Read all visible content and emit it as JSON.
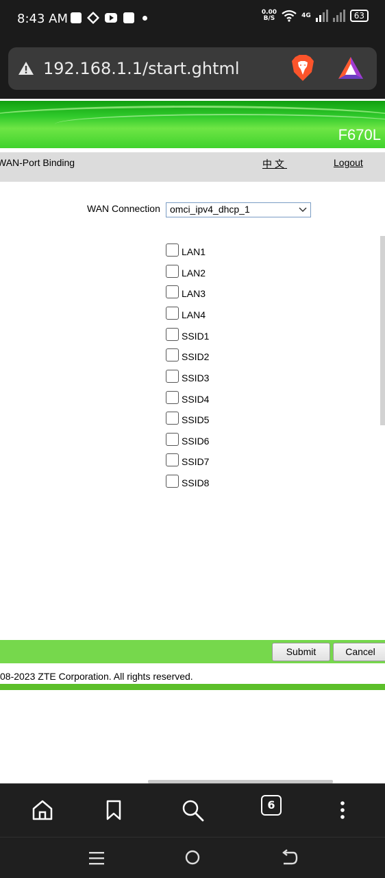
{
  "status_bar": {
    "time": "8:43 AM",
    "net_speed_value": "0.00",
    "net_speed_unit": "B/S",
    "network_type": "4G",
    "battery": "63"
  },
  "address_bar": {
    "url": "192.168.1.1/start.ghtml"
  },
  "page": {
    "model": "F670L",
    "nav": {
      "title": "WAN-Port Binding",
      "language": "中文",
      "logout": "Logout"
    },
    "wan_connection": {
      "label": "WAN Connection",
      "selected": "omci_ipv4_dhcp_1"
    },
    "ports": [
      {
        "label": "LAN1",
        "checked": false
      },
      {
        "label": "LAN2",
        "checked": false
      },
      {
        "label": "LAN3",
        "checked": false
      },
      {
        "label": "LAN4",
        "checked": false
      },
      {
        "label": "SSID1",
        "checked": false
      },
      {
        "label": "SSID2",
        "checked": false
      },
      {
        "label": "SSID3",
        "checked": false
      },
      {
        "label": "SSID4",
        "checked": false
      },
      {
        "label": "SSID5",
        "checked": false
      },
      {
        "label": "SSID6",
        "checked": false
      },
      {
        "label": "SSID7",
        "checked": false
      },
      {
        "label": "SSID8",
        "checked": false
      }
    ],
    "buttons": {
      "submit": "Submit",
      "cancel": "Cancel"
    },
    "copyright": "08-2023 ZTE Corporation. All rights reserved."
  },
  "toolbar": {
    "tab_count": "6"
  },
  "colors": {
    "banner_green": "#2fc92b",
    "bar_green": "#76d84c",
    "footer_green": "#5cbf2a",
    "nav_gray": "#dcdcdc",
    "chrome_dark": "#1b1b1b"
  }
}
